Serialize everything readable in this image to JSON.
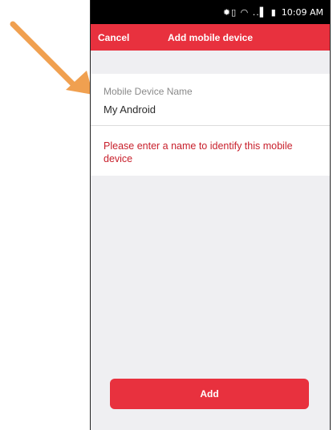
{
  "status_bar": {
    "icons": "✹▯ ◠ ..▌ ▮",
    "time": "10:09 AM"
  },
  "header": {
    "cancel_label": "Cancel",
    "title": "Add mobile device"
  },
  "form": {
    "field_label": "Mobile Device Name",
    "field_value": "My Android",
    "hint": "Please enter a name to identify this mobile device"
  },
  "add_button_label": "Add",
  "colors": {
    "accent": "#e8313e",
    "hint_text": "#c8202c",
    "annotation_arrow": "#f0a050"
  }
}
